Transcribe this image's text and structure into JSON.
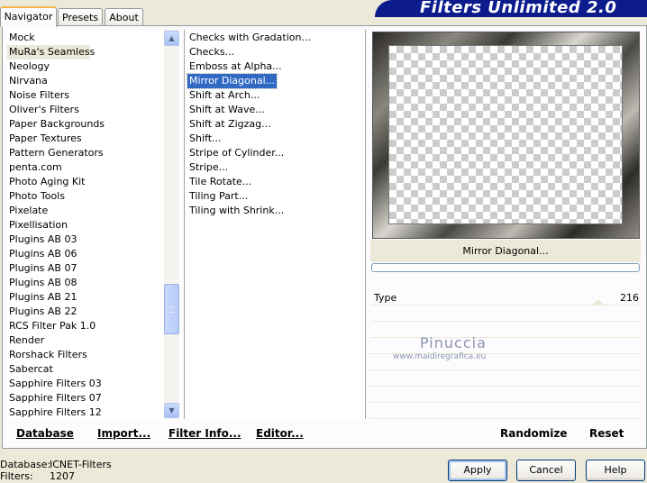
{
  "tabs": [
    {
      "label": "Navigator",
      "active": true
    },
    {
      "label": "Presets",
      "active": false
    },
    {
      "label": "About",
      "active": false
    }
  ],
  "title": "Filters Unlimited 2.0",
  "categories": [
    "Mock",
    "MuRa's Seamless",
    "Neology",
    "Nirvana",
    "Noise Filters",
    "Oliver's Filters",
    "Paper Backgrounds",
    "Paper Textures",
    "Pattern Generators",
    "penta.com",
    "Photo Aging Kit",
    "Photo Tools",
    "Pixelate",
    "Pixellisation",
    "Plugins AB 03",
    "Plugins AB 06",
    "Plugins AB 07",
    "Plugins AB 08",
    "Plugins AB 21",
    "Plugins AB 22",
    "RCS Filter Pak 1.0",
    "Render",
    "Rorshack Filters",
    "Sabercat",
    "Sapphire Filters 03",
    "Sapphire Filters 07",
    "Sapphire Filters 12"
  ],
  "selected_category": "MuRa's Seamless",
  "filters": [
    "Checks with Gradation...",
    "Checks...",
    "Emboss at Alpha...",
    "Mirror Diagonal...",
    "Shift at Arch...",
    "Shift at Wave...",
    "Shift at Zigzag...",
    "Shift...",
    "Stripe of Cylinder...",
    "Stripe...",
    "Tile Rotate...",
    "Tiling Part...",
    "Tiling with Shrink..."
  ],
  "selected_filter": "Mirror Diagonal...",
  "preview": {
    "filter_name": "Mirror Diagonal..."
  },
  "params": [
    {
      "label": "Type",
      "value": "216"
    }
  ],
  "watermark": {
    "name": "Pinuccia",
    "site": "www.maidiregrafica.eu"
  },
  "bottom_buttons": {
    "database": "Database",
    "import": "Import...",
    "filter_info": "Filter Info...",
    "editor": "Editor...",
    "randomize": "Randomize",
    "reset": "Reset"
  },
  "status": {
    "database_label": "Database:",
    "database_value": "ICNET-Filters",
    "filters_label": "Filters:",
    "filters_value": "1207"
  },
  "dialog_buttons": {
    "apply": "Apply",
    "cancel": "Cancel",
    "help": "Help"
  },
  "colors": {
    "banner": "#0c1c8c",
    "selection": "#316ac5",
    "dialog_bg": "#ece9d8"
  }
}
